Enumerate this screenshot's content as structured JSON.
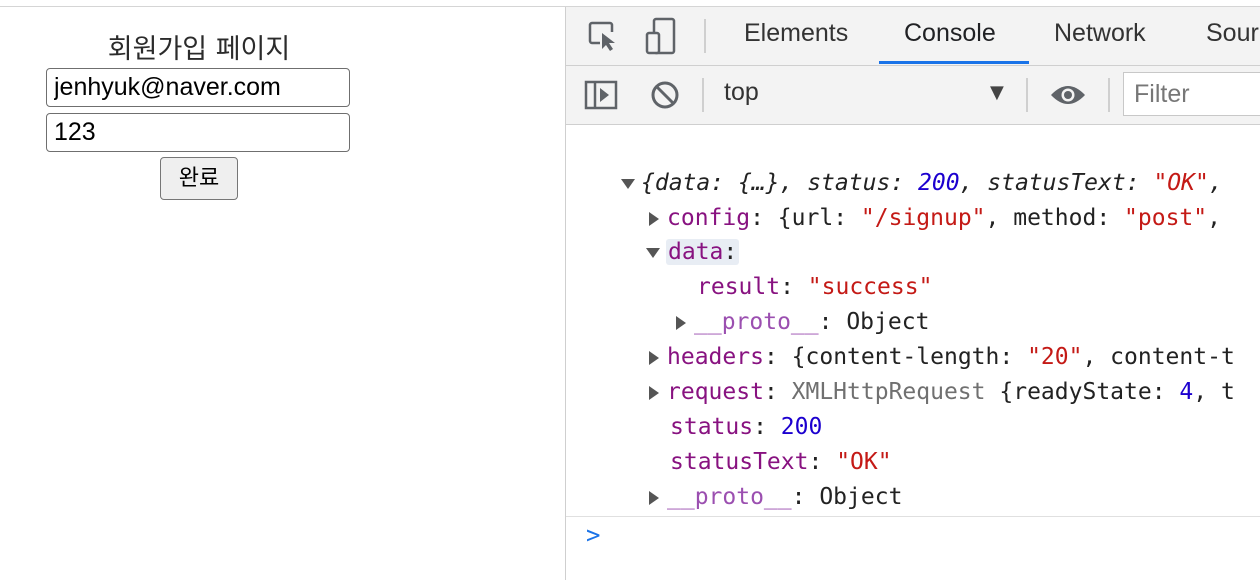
{
  "page": {
    "title": "회원가입 페이지",
    "email_value": "jenhyuk@naver.com",
    "password_value": "123",
    "submit_label": "완료"
  },
  "devtools": {
    "tabs": [
      "Elements",
      "Console",
      "Network",
      "Sour"
    ],
    "active_tab": "Console",
    "context": "top",
    "filter_placeholder": "Filter",
    "accent_color": "#1a73e8"
  },
  "console": {
    "summary": {
      "open": "{",
      "data_key": "data",
      "data_val": "{…}",
      "status_key": "status",
      "status_val": "200",
      "statusText_key": "statusText",
      "statusText_val": "\"OK\"",
      "tail": ","
    },
    "config": {
      "key": "config",
      "open": "{",
      "url_key": "url",
      "url_val": "\"/signup\"",
      "method_key": "method",
      "method_val": "\"post\"",
      "tail": ","
    },
    "data": {
      "key": "data",
      "result_key": "result",
      "result_val": "\"success\"",
      "proto_key": "__proto__",
      "proto_val": "Object"
    },
    "headers": {
      "key": "headers",
      "open": "{",
      "cl_key": "content-length",
      "cl_val": "\"20\"",
      "tail": ", content-t"
    },
    "request": {
      "key": "request",
      "type": "XMLHttpRequest",
      "open": "{",
      "rs_key": "readyState",
      "rs_val": "4",
      "tail": ", t"
    },
    "status": {
      "key": "status",
      "val": "200"
    },
    "statusText": {
      "key": "statusText",
      "val": "\"OK\""
    },
    "proto": {
      "key": "__proto__",
      "val": "Object"
    },
    "prompt": ">"
  }
}
